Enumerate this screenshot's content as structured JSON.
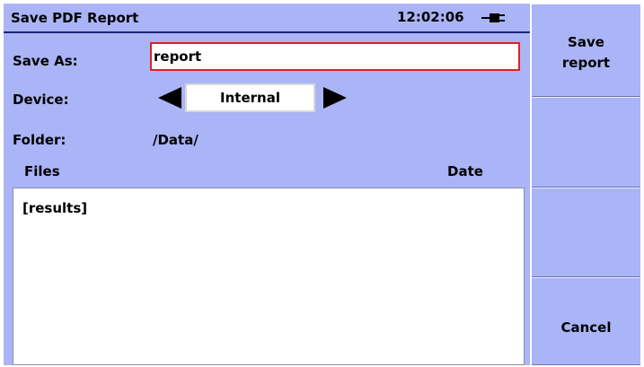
{
  "title": "Save PDF Report",
  "status": {
    "time": "12:02:06",
    "power_icon": "plug-icon"
  },
  "form": {
    "save_as_label": "Save As:",
    "save_as_value": "report",
    "device_label": "Device:",
    "device_value": "Internal",
    "folder_label": "Folder:",
    "folder_value": "/Data/"
  },
  "file_list": {
    "files_header": "Files",
    "date_header": "Date",
    "items": [
      "[results]"
    ]
  },
  "softkeys": [
    {
      "line1": "Save",
      "line2": "report"
    },
    {
      "line1": "",
      "line2": ""
    },
    {
      "line1": "",
      "line2": ""
    },
    {
      "line1": "Cancel",
      "line2": ""
    }
  ],
  "colors": {
    "panel": "#aab4f6",
    "input_border_active": "#dd2222",
    "dark_line": "#1e2578"
  }
}
